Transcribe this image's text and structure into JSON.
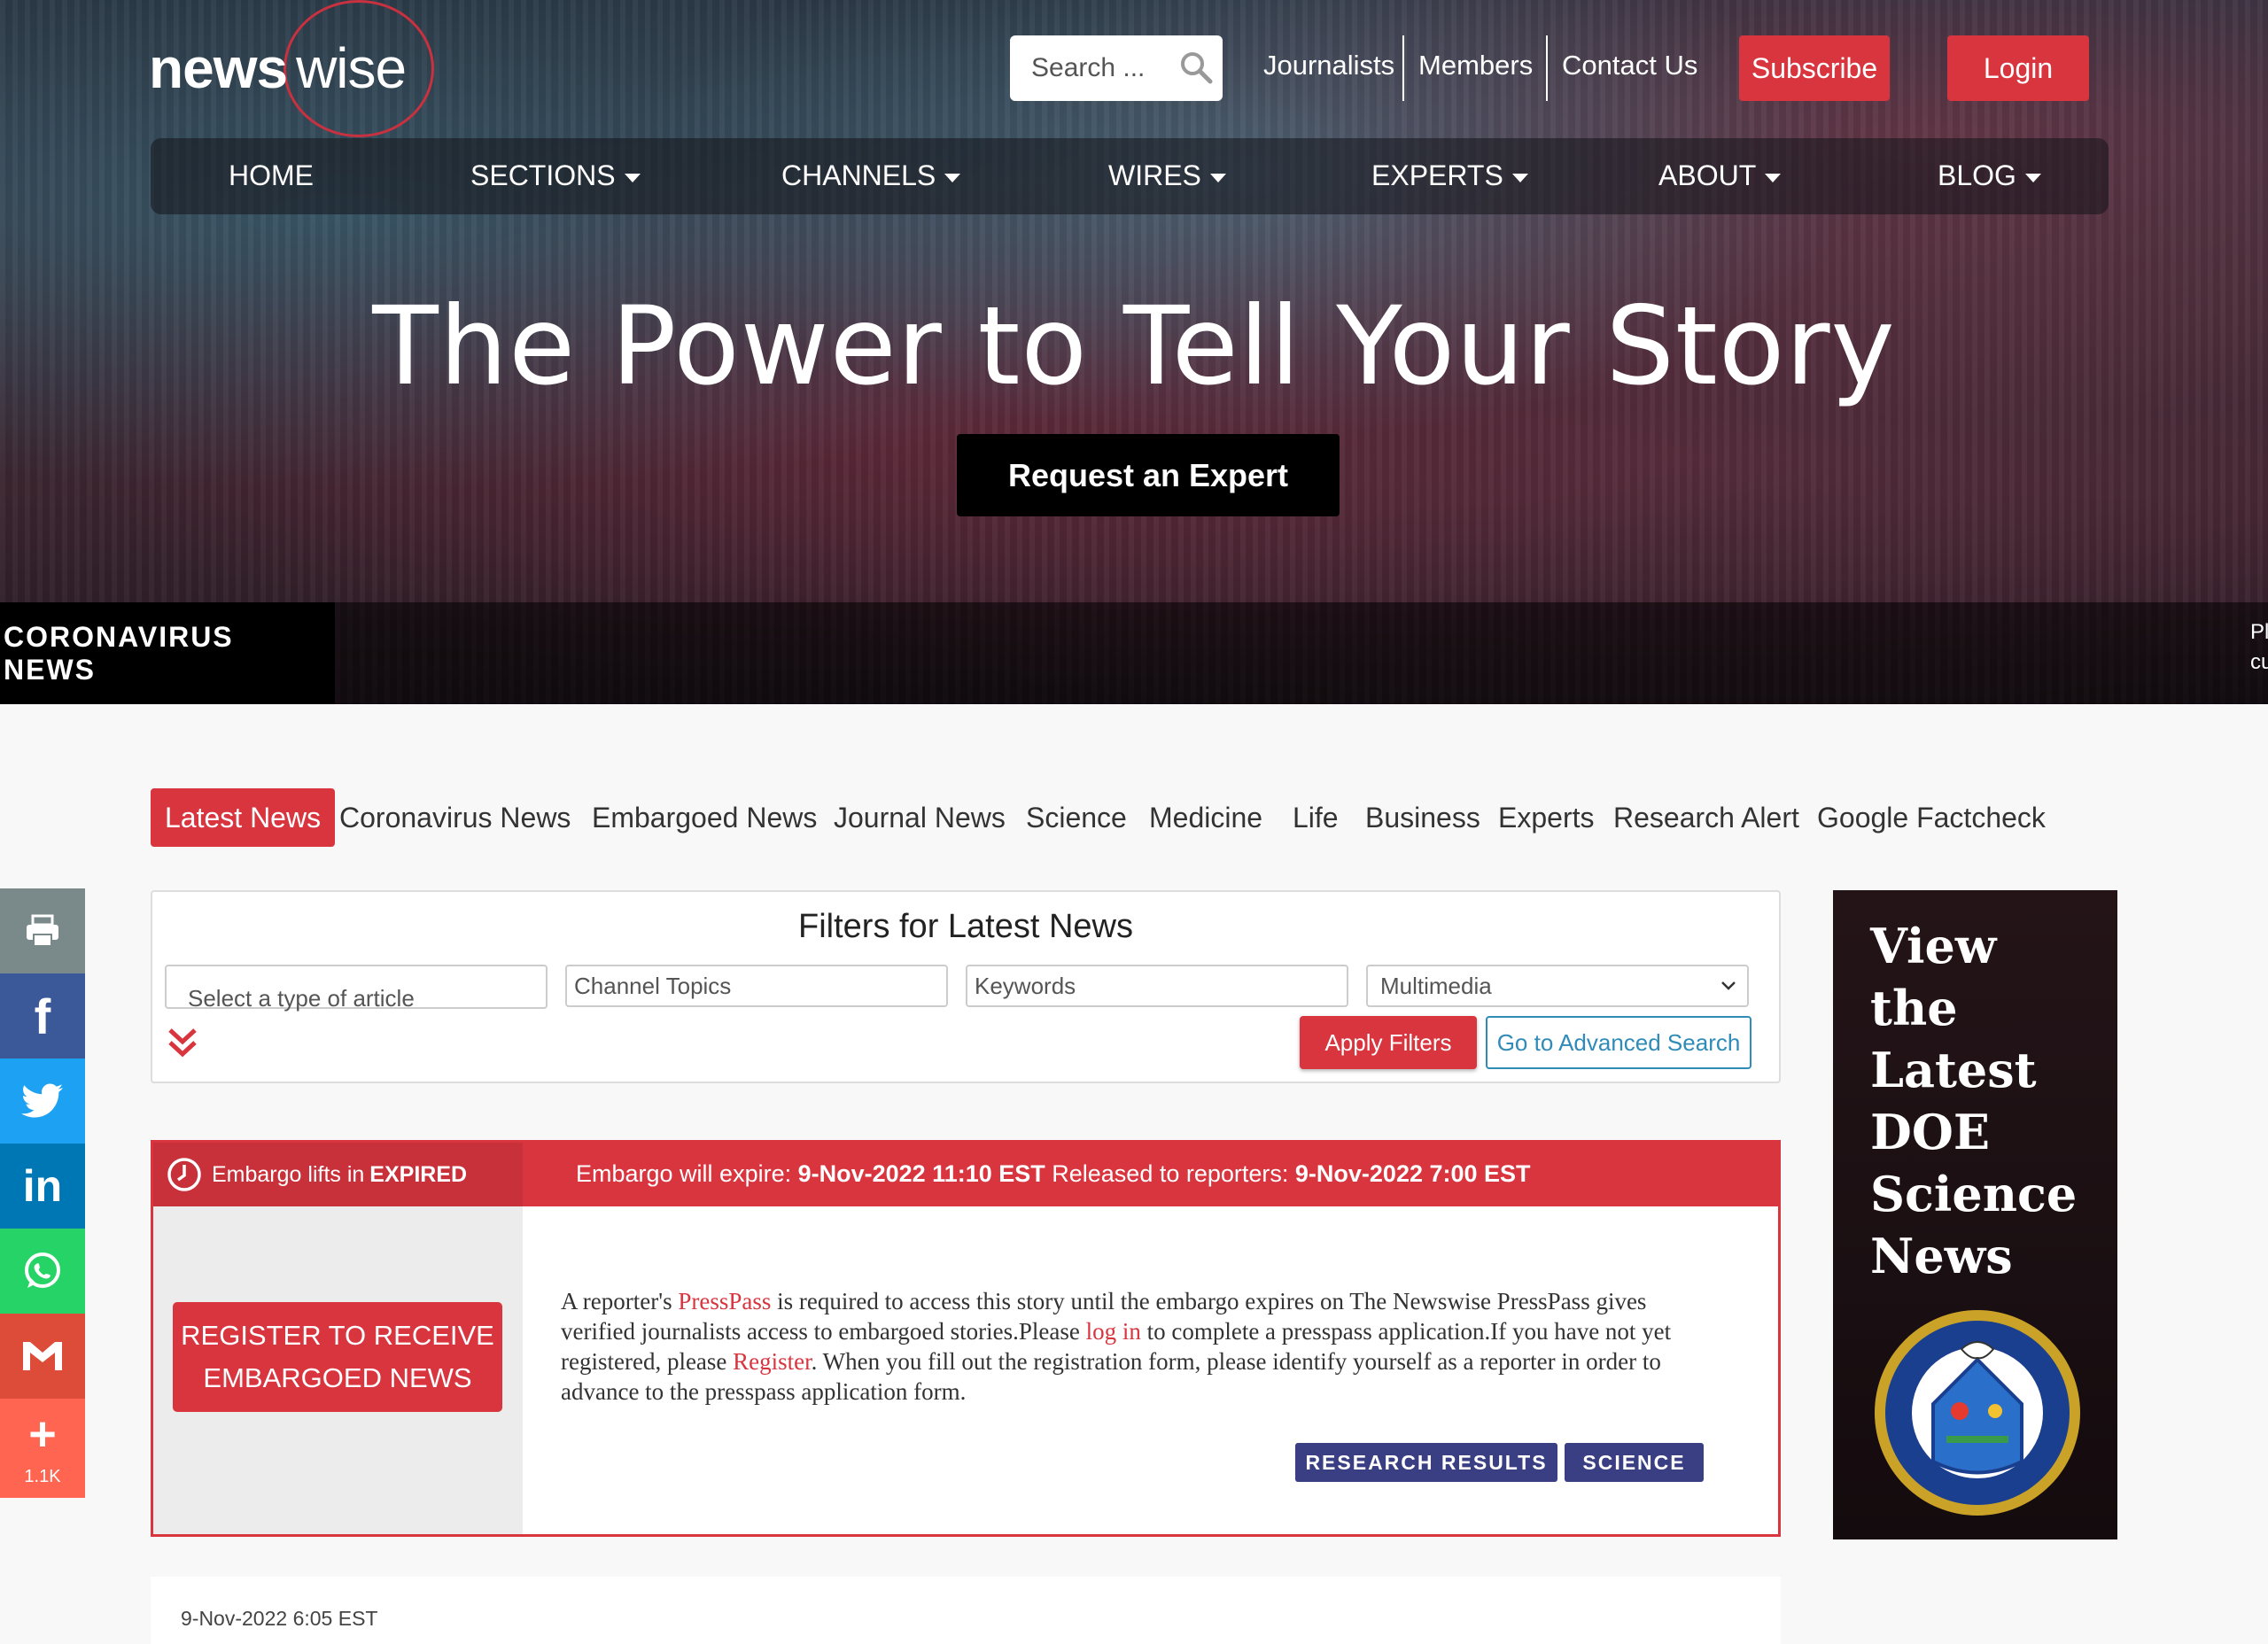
{
  "brand": {
    "logo_bold": "news",
    "logo_light": "wise"
  },
  "search": {
    "placeholder": "Search ..."
  },
  "top_links": [
    "Journalists",
    "Members",
    "Contact Us"
  ],
  "buttons": {
    "subscribe": "Subscribe",
    "login": "Login"
  },
  "nav": [
    {
      "label": "HOME",
      "dropdown": false
    },
    {
      "label": "SECTIONS",
      "dropdown": true
    },
    {
      "label": "CHANNELS",
      "dropdown": true
    },
    {
      "label": "WIRES",
      "dropdown": true
    },
    {
      "label": "EXPERTS",
      "dropdown": true
    },
    {
      "label": "ABOUT",
      "dropdown": true
    },
    {
      "label": "BLOG",
      "dropdown": true
    }
  ],
  "hero": {
    "headline": "The Power to Tell Your Story",
    "cta": "Request an Expert"
  },
  "ticker": {
    "label": "CORONAVIRUS NEWS",
    "edge_line1": "Pl",
    "edge_line2": "cu"
  },
  "tabs": [
    "Latest News",
    "Coronavirus News",
    "Embargoed News",
    "Journal News",
    "Science",
    "Medicine",
    "Life",
    "Business",
    "Experts",
    "Research Alert",
    "Google Factcheck"
  ],
  "share": {
    "count": "1.1K"
  },
  "filters": {
    "title": "Filters for Latest News",
    "article_type_placeholder": "Select a type of article",
    "channel_placeholder": "Channel Topics",
    "keywords_placeholder": "Keywords",
    "multimedia_value": "Multimedia",
    "apply": "Apply Filters",
    "advanced": "Go to Advanced Search"
  },
  "embargo": {
    "lifts_prefix": "Embargo lifts in ",
    "lifts_status": "EXPIRED",
    "expire_label": "Embargo will expire: ",
    "expire_value": "9-Nov-2022 11:10 EST",
    "released_label": " Released to reporters: ",
    "released_value": "9-Nov-2022 7:00 EST",
    "register_line1": "REGISTER TO RECEIVE",
    "register_line2": "EMBARGOED NEWS",
    "text_1": "A reporter's ",
    "link_presspass": "PressPass",
    "text_2": " is required to access this story until the embargo expires on The Newswise PressPass gives verified journalists access to embargoed stories.Please ",
    "link_login": "log in",
    "text_3": " to complete a presspass application.If you have not yet registered, please ",
    "link_register": "Register",
    "text_4": ". When you fill out the registration form, please identify yourself as a reporter in order to advance to the presspass application form.",
    "tags": [
      "RESEARCH RESULTS",
      "SCIENCE"
    ]
  },
  "ad": {
    "lines": [
      "View",
      "the",
      "Latest",
      "DOE",
      "Science",
      "News"
    ]
  },
  "next_article": {
    "date": "9-Nov-2022 6:05 EST"
  },
  "colors": {
    "accent_red": "#d8353f",
    "tag_blue": "#3a3e82",
    "link_blue": "#2f8bb8"
  }
}
